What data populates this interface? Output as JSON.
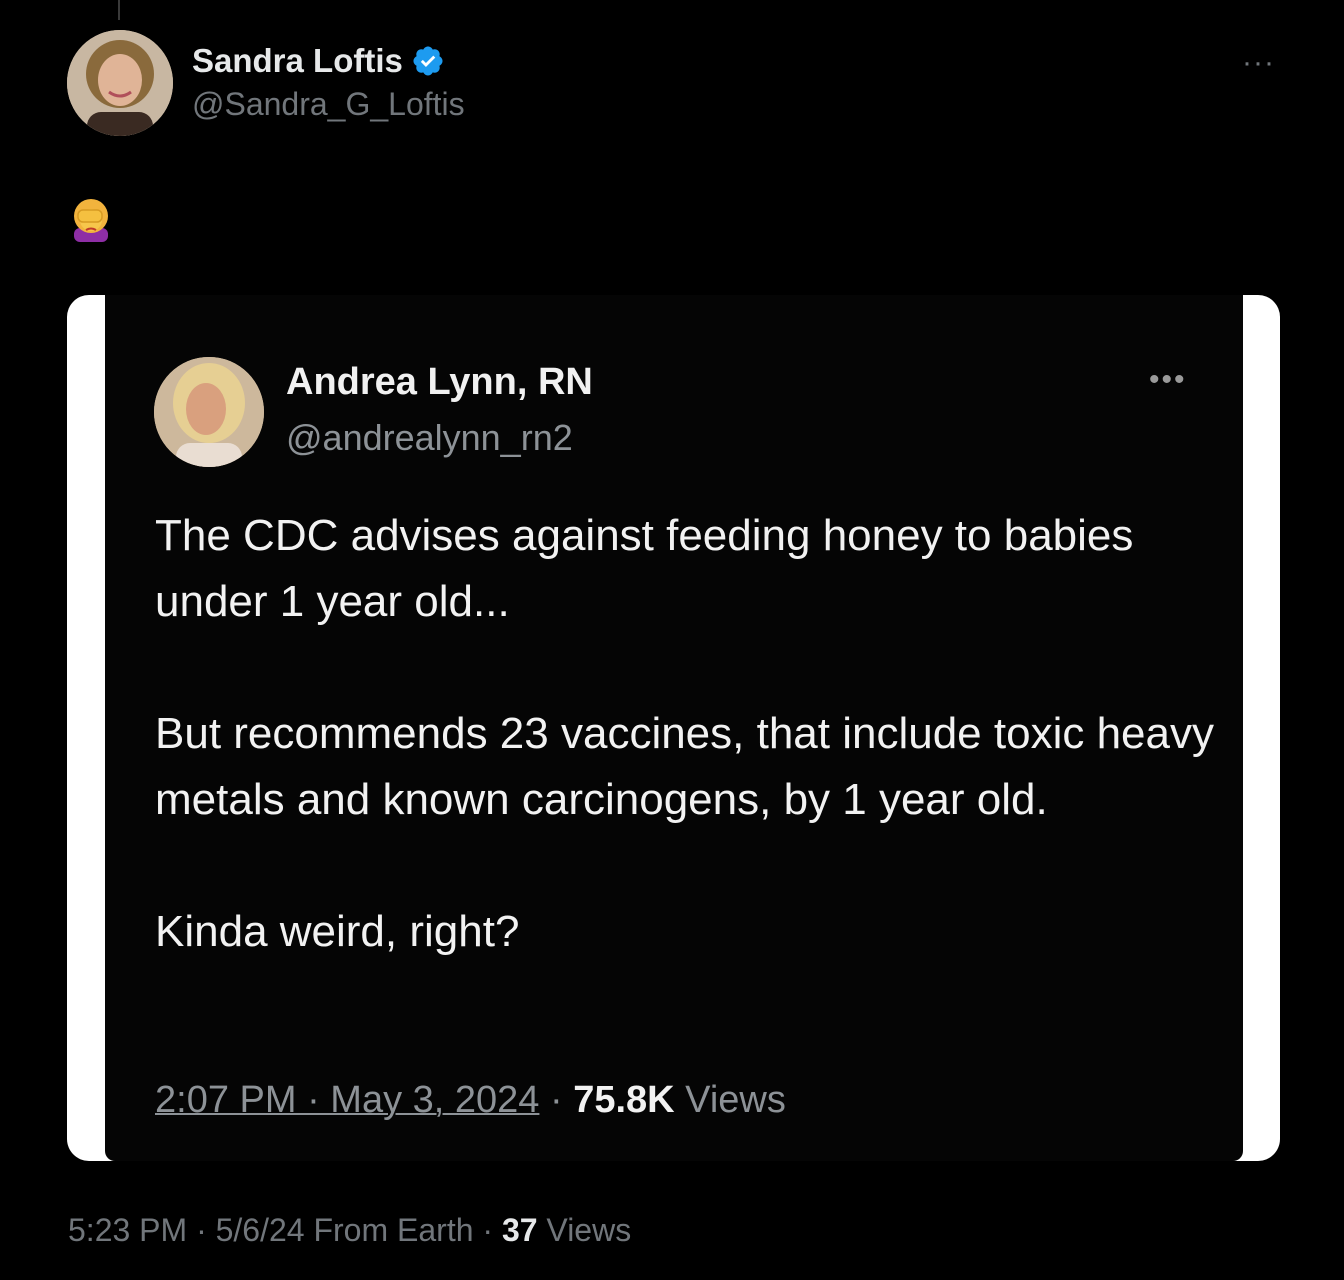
{
  "tweet": {
    "author_name": "Sandra Loftis",
    "author_handle": "@Sandra_G_Loftis",
    "more_label": "···",
    "text_emoji": "woman-facepalming-emoji",
    "timestamp": "5:23 PM",
    "separator": "·",
    "date": "5/6/24",
    "source": "From Earth",
    "views_count": "37",
    "views_label": "Views"
  },
  "quoted_image": {
    "author_name": "Andrea Lynn, RN",
    "author_handle": "@andrealynn_rn2",
    "more_label": "•••",
    "paragraphs": [
      "The CDC advises against feeding honey to babies under 1 year old...",
      "But recommends 23 vaccines, that include toxic heavy metals and known carcinogens, by 1 year old.",
      "Kinda weird, right?"
    ],
    "datetime": "2:07 PM · May 3, 2024",
    "separator": "·",
    "views_count": "75.8K",
    "views_label": "Views"
  },
  "colors": {
    "background": "#000000",
    "verified_badge": "#1d9bf0",
    "muted_text": "#71767b"
  }
}
